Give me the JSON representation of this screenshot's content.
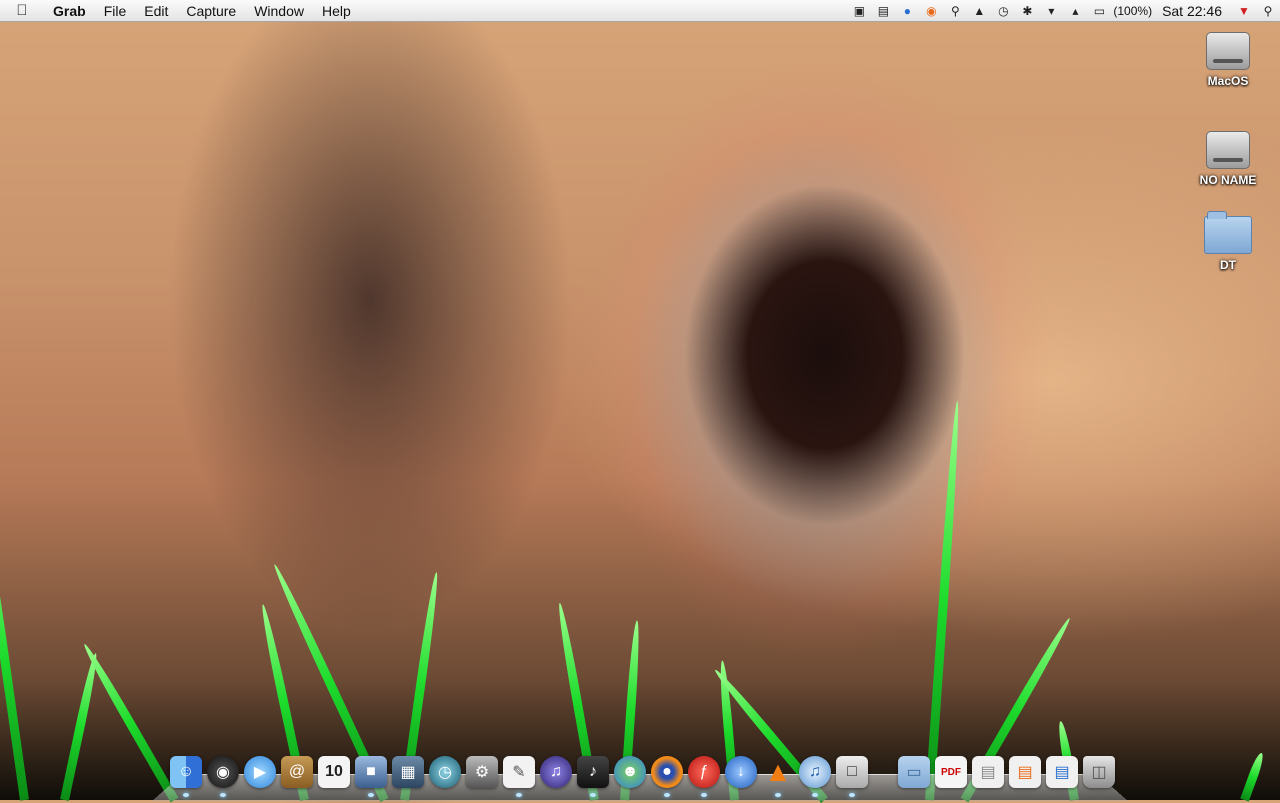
{
  "menubar": {
    "apple": "",
    "app_name": "Grab",
    "menus": [
      "File",
      "Edit",
      "Capture",
      "Window",
      "Help"
    ],
    "battery_percent": "(100%)",
    "clock": "Sat 22:46"
  },
  "desktop": {
    "icons": [
      {
        "label": "MacOS",
        "icon": "hard-drive-icon"
      },
      {
        "label": "NO NAME",
        "icon": "hard-drive-icon"
      },
      {
        "label": "DT",
        "icon": "folder-icon"
      }
    ]
  },
  "status_icons": [
    "script-icon",
    "display-icon",
    "globe-icon",
    "firefox-icon",
    "spotlight-glass-icon",
    "lock-icon",
    "time-machine-icon",
    "bluetooth-icon",
    "wifi-icon",
    "volume-icon",
    "battery-icon",
    "shield-icon",
    "search-icon"
  ],
  "dock": {
    "items": [
      {
        "name": "finder",
        "icon": "finder-icon",
        "color": "#3c82e0"
      },
      {
        "name": "dashboard",
        "icon": "dashboard-icon",
        "color": "#333"
      },
      {
        "name": "ichat",
        "icon": "ichat-icon",
        "color": "#4aa3f0"
      },
      {
        "name": "address-book",
        "icon": "address-book-icon",
        "color": "#a77a3a"
      },
      {
        "name": "ical",
        "icon": "ical-icon",
        "color": "#e8e8e8"
      },
      {
        "name": "iphoto",
        "icon": "iphoto-icon",
        "color": "#5f86b5"
      },
      {
        "name": "expose",
        "icon": "expose-icon",
        "color": "#3d5d7d"
      },
      {
        "name": "time-machine",
        "icon": "time-machine-icon",
        "color": "#2d7a8f"
      },
      {
        "name": "system-preferences",
        "icon": "system-preferences-icon",
        "color": "#777"
      },
      {
        "name": "textedit",
        "icon": "textedit-icon",
        "color": "#ddd"
      },
      {
        "name": "itunes-helper",
        "icon": "media-icon",
        "color": "#4b3f9e"
      },
      {
        "name": "guitar",
        "icon": "guitar-icon",
        "color": "#222"
      },
      {
        "name": "messenger",
        "icon": "messenger-icon",
        "color": "#3ca0e6"
      },
      {
        "name": "firefox",
        "icon": "firefox-icon",
        "color": "#e86a1a"
      },
      {
        "name": "flash",
        "icon": "flash-icon",
        "color": "#d4201f"
      },
      {
        "name": "downloader",
        "icon": "download-icon",
        "color": "#2e6fd1"
      },
      {
        "name": "vlc",
        "icon": "vlc-icon",
        "color": "#f07e12"
      },
      {
        "name": "itunes",
        "icon": "itunes-icon",
        "color": "#6aa3d8"
      },
      {
        "name": "utility",
        "icon": "utility-icon",
        "color": "#cfcfcf"
      },
      {
        "name": "applications-folder",
        "icon": "folder-icon",
        "color": "#8cb2dc"
      },
      {
        "name": "document",
        "icon": "pdf-icon",
        "color": "#f1f1f1"
      },
      {
        "name": "window-1",
        "icon": "window-icon",
        "color": "#eaeaea"
      },
      {
        "name": "window-2",
        "icon": "window-icon",
        "color": "#eaeaea"
      },
      {
        "name": "window-3",
        "icon": "window-icon",
        "color": "#eaeaea"
      },
      {
        "name": "trash",
        "icon": "trash-icon",
        "color": "#b9b9b9"
      }
    ]
  }
}
